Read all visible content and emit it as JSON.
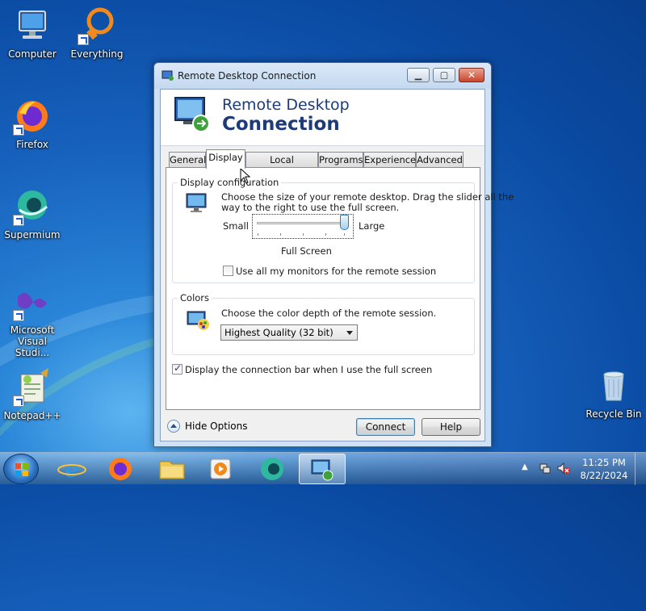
{
  "desktop": {
    "icons": [
      {
        "label": "Computer"
      },
      {
        "label": "Everything"
      },
      {
        "label": "Firefox"
      },
      {
        "label": "Supermium"
      },
      {
        "label": "Microsoft Visual Studi..."
      },
      {
        "label": "Notepad++"
      },
      {
        "label": "Recycle Bin"
      }
    ]
  },
  "window": {
    "title": "Remote Desktop Connection",
    "banner_line1": "Remote Desktop",
    "banner_line2": "Connection",
    "tabs": [
      {
        "label": "General"
      },
      {
        "label": "Display",
        "active": true
      },
      {
        "label": "Local Resources"
      },
      {
        "label": "Programs"
      },
      {
        "label": "Experience"
      },
      {
        "label": "Advanced"
      }
    ],
    "display_config": {
      "title": "Display configuration",
      "description_line1": "Choose the size of your remote desktop. Drag the slider all the",
      "description_line2": "way to the right to use the full screen.",
      "slider_min_label": "Small",
      "slider_max_label": "Large",
      "slider_value_label": "Full Screen",
      "slider_position_fraction": 1.0,
      "monitors_checkbox_label": "Use all my monitors for the remote session",
      "monitors_checked": false
    },
    "colors": {
      "title": "Colors",
      "description": "Choose the color depth of the remote session.",
      "selected_depth": "Highest Quality (32 bit)"
    },
    "connection_bar_label": "Display the connection bar when I use the full screen",
    "connection_bar_checked": true,
    "hide_options_label": "Hide Options",
    "connect_label": "Connect",
    "help_label": "Help"
  },
  "taskbar": {
    "time": "11:25 PM",
    "date": "8/22/2024"
  }
}
